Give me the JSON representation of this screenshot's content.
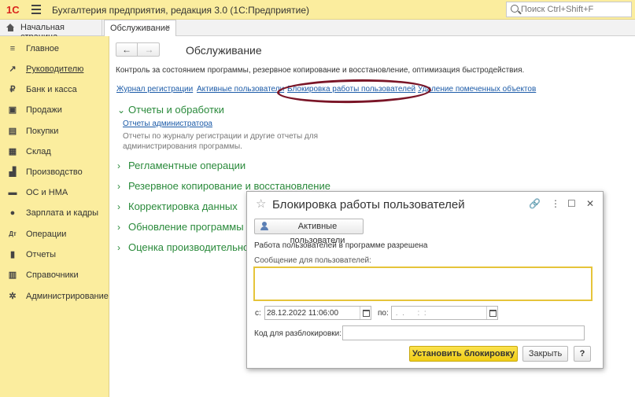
{
  "app": {
    "logo": "1С",
    "title": "Бухгалтерия предприятия, редакция 3.0  (1С:Предприятие)",
    "search_placeholder": "Поиск Ctrl+Shift+F"
  },
  "tabs": {
    "home_label": "Начальная страница",
    "active_label": "Обслуживание",
    "close_glyph": "×"
  },
  "sidebar": {
    "items": [
      {
        "label": "Главное",
        "icon": "menu-icon",
        "glyph": "≡"
      },
      {
        "label": "Руководителю",
        "icon": "trend-icon",
        "glyph": "↗"
      },
      {
        "label": "Банк и касса",
        "icon": "coin-icon",
        "glyph": "₽"
      },
      {
        "label": "Продажи",
        "icon": "bag-icon",
        "glyph": "▣"
      },
      {
        "label": "Покупки",
        "icon": "cart-icon",
        "glyph": "▤"
      },
      {
        "label": "Склад",
        "icon": "warehouse-icon",
        "glyph": "▦"
      },
      {
        "label": "Производство",
        "icon": "factory-icon",
        "glyph": "▟"
      },
      {
        "label": "ОС и НМА",
        "icon": "truck-icon",
        "glyph": "▬"
      },
      {
        "label": "Зарплата и кадры",
        "icon": "person-icon",
        "glyph": "●"
      },
      {
        "label": "Операции",
        "icon": "dt-kt-icon",
        "glyph": "Дт"
      },
      {
        "label": "Отчеты",
        "icon": "report-icon",
        "glyph": "▮"
      },
      {
        "label": "Справочники",
        "icon": "book-icon",
        "glyph": "▥"
      },
      {
        "label": "Администрирование",
        "icon": "gear-icon",
        "glyph": "✲"
      }
    ]
  },
  "main": {
    "nav_back": "←",
    "nav_forward": "→",
    "title": "Обслуживание",
    "description": "Контроль за состоянием программы, резервное копирование и восстановление, оптимизация быстродействия.",
    "links": [
      "Журнал регистрации",
      "Активные пользователи",
      "Блокировка работы пользователей",
      "Удаление помеченных объектов"
    ],
    "sections": [
      {
        "label": "Отчеты и обработки",
        "expanded": true
      },
      {
        "label": "Регламентные операции",
        "expanded": false
      },
      {
        "label": "Резервное копирование и восстановление",
        "expanded": false
      },
      {
        "label": "Корректировка данных",
        "expanded": false
      },
      {
        "label": "Обновление программы",
        "expanded": false
      },
      {
        "label": "Оценка производительности",
        "expanded": false
      }
    ],
    "admin_reports_link": "Отчеты администратора",
    "admin_reports_desc": "Отчеты по журналу регистрации и другие отчеты для администрирования программы.",
    "highlight_color": "#7a1527"
  },
  "dialog": {
    "title": "Блокировка работы пользователей",
    "star": "☆",
    "controls": {
      "link": "🔗",
      "more": "⋮",
      "maximize": "☐",
      "close": "✕"
    },
    "active_users_button": "Активные пользователи",
    "status": "Работа пользователей в программе разрешена",
    "message_label": "Сообщение для пользователей:",
    "message_value": "",
    "from_label": "с:",
    "from_value": "28.12.2022 11:06:00",
    "to_label": "по:",
    "to_value": " .  .      :  :",
    "unlock_code_label": "Код для разблокировки:",
    "unlock_code_value": "",
    "set_lock_button": "Установить блокировку",
    "close_button": "Закрыть",
    "help_button": "?",
    "accent_color": "#f0cd16"
  }
}
